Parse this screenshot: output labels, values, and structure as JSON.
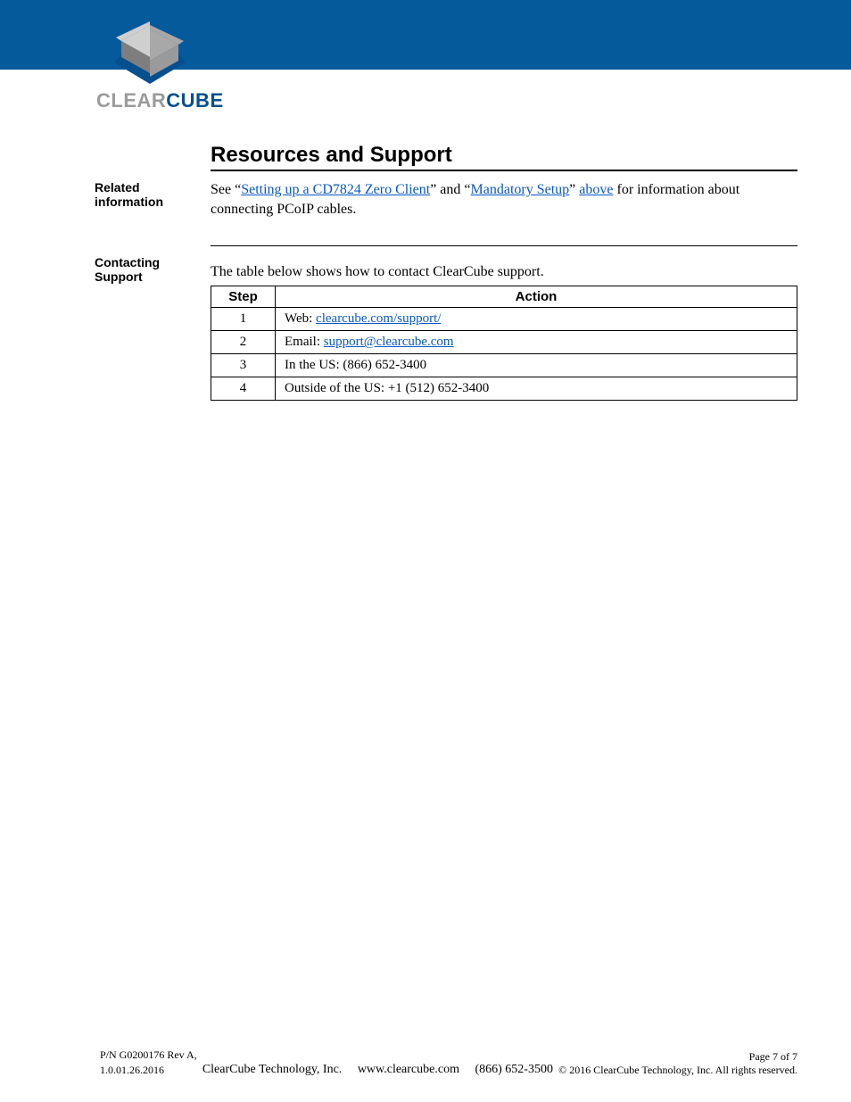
{
  "logo": {
    "text_clear": "CLEAR",
    "text_cube": "CUBE"
  },
  "section": {
    "title": "Resources and Support",
    "related_label": "Related information",
    "related": {
      "pre": "See ",
      "q1": "“",
      "link1": "Setting up a CD7824 Zero Client",
      "mid": "” and “",
      "link2": "Mandatory Setup",
      "q2": "” ",
      "above_link": "above",
      "tail": " for information about connecting PCoIP cables."
    },
    "contacting_label": "Contacting Support",
    "steps_intro": "The table below shows how to contact ClearCube support.",
    "table_headers": {
      "step": "Step",
      "action": "Action"
    },
    "rows": [
      {
        "n": "1",
        "pre": "Web: ",
        "link": "clearcube.com/support/",
        "tail": ""
      },
      {
        "n": "2",
        "pre": "Email: ",
        "link": "support@clearcube.com",
        "tail": ""
      },
      {
        "n": "3",
        "pre": "",
        "link": "",
        "tail": "In the US: (866) 652-3400"
      },
      {
        "n": "4",
        "pre": "",
        "link": "",
        "tail": "Outside of the US: +1 (512) 652-3400"
      }
    ]
  },
  "footer": {
    "pn": "P/N G0200176 Rev A,",
    "rev": "1.0.01.26.2016",
    "mid_a": "ClearCube Technology, Inc.",
    "mid_b": "www.clearcube.com",
    "mid_c": "(866) 652-3500",
    "page": "Page 7 of 7",
    "copyright": "© 2016 ClearCube Technology, Inc. All rights reserved."
  }
}
